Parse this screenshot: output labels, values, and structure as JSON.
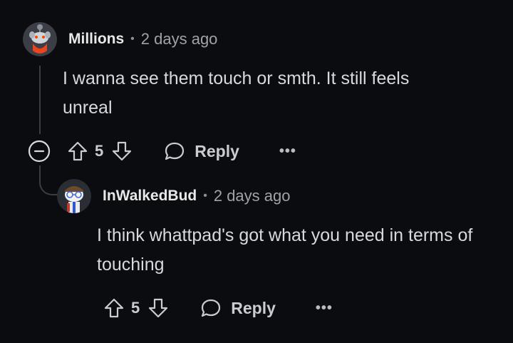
{
  "comments": [
    {
      "username": "Millions",
      "separator": "•",
      "time": "2 days ago",
      "body": "I wanna see them touch or smth. It still feels unreal",
      "votes": "5",
      "reply_label": "Reply",
      "more_label": "•••",
      "avatar_icon": "snoo-avatar-icon"
    },
    {
      "username": "InWalkedBud",
      "separator": "•",
      "time": "2 days ago",
      "body": "I think whattpad's got what you need in terms of touching",
      "votes": "5",
      "reply_label": "Reply",
      "more_label": "•••",
      "avatar_icon": "snoo-avatar-icon"
    }
  ],
  "colors": {
    "background": "#0b0c0f",
    "text": "#d7dadc",
    "muted": "#9ea3a8",
    "thread_line": "#3a3d42"
  }
}
